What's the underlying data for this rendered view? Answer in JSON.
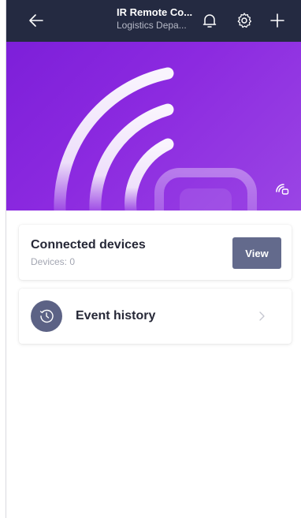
{
  "header": {
    "title": "IR Remote Co...",
    "subtitle": "Logistics Depa...",
    "icons": [
      "back-arrow-icon",
      "bell-icon",
      "gear-icon",
      "plus-icon"
    ]
  },
  "colors": {
    "header_bg": "#242a41",
    "hero_gradient_start": "#7d1fd9",
    "hero_gradient_end": "#9a45e4",
    "button_bg": "#636a8c",
    "history_icon_bg": "#5c6285"
  },
  "devices_card": {
    "title": "Connected devices",
    "count_text": "Devices: 0",
    "view_label": "View"
  },
  "history_card": {
    "label": "Event history"
  }
}
